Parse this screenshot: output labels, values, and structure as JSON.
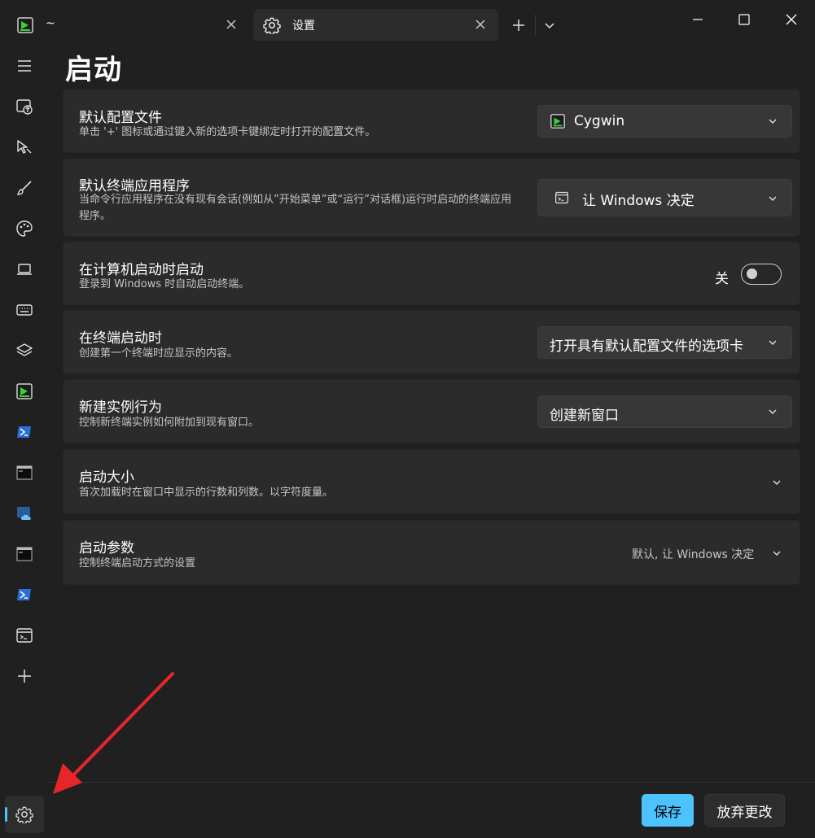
{
  "tabs": [
    {
      "title": "~",
      "icon": "cygwin-terminal-icon"
    },
    {
      "title": "设置",
      "icon": "gear-icon"
    }
  ],
  "page_title": "启动",
  "settings": {
    "default_profile": {
      "title": "默认配置文件",
      "description": "单击 '+' 图标或通过键入新的选项卡键绑定时打开的配置文件。",
      "value": "Cygwin"
    },
    "default_terminal": {
      "title": "默认终端应用程序",
      "description": "当命令行应用程序在没有现有会话(例如从”开始菜单”或“运行”对话框)运行时启动的终端应用程序。",
      "value": "让 Windows 决定"
    },
    "launch_on_startup": {
      "title": "在计算机启动时启动",
      "description": "登录到 Windows 时自动启动终端。",
      "toggle_label": "关",
      "checked": false
    },
    "on_terminal_start": {
      "title": "在终端启动时",
      "description": "创建第一个终端时应显示的内容。",
      "value": "打开具有默认配置文件的选项卡"
    },
    "new_instance": {
      "title": "新建实例行为",
      "description": "控制新终端实例如何附加到现有窗口。",
      "value": "创建新窗口"
    },
    "launch_size": {
      "title": "启动大小",
      "description": "首次加载时在窗口中显示的行数和列数。以字符度量。"
    },
    "launch_params": {
      "title": "启动参数",
      "description": "控制终端启动方式的设置",
      "summary": "默认, 让 Windows 决定"
    }
  },
  "footer": {
    "save_label": "保存",
    "discard_label": "放弃更改"
  },
  "colors": {
    "accent": "#4cc2ff",
    "background": "#202020",
    "card": "#2b2b2b"
  }
}
